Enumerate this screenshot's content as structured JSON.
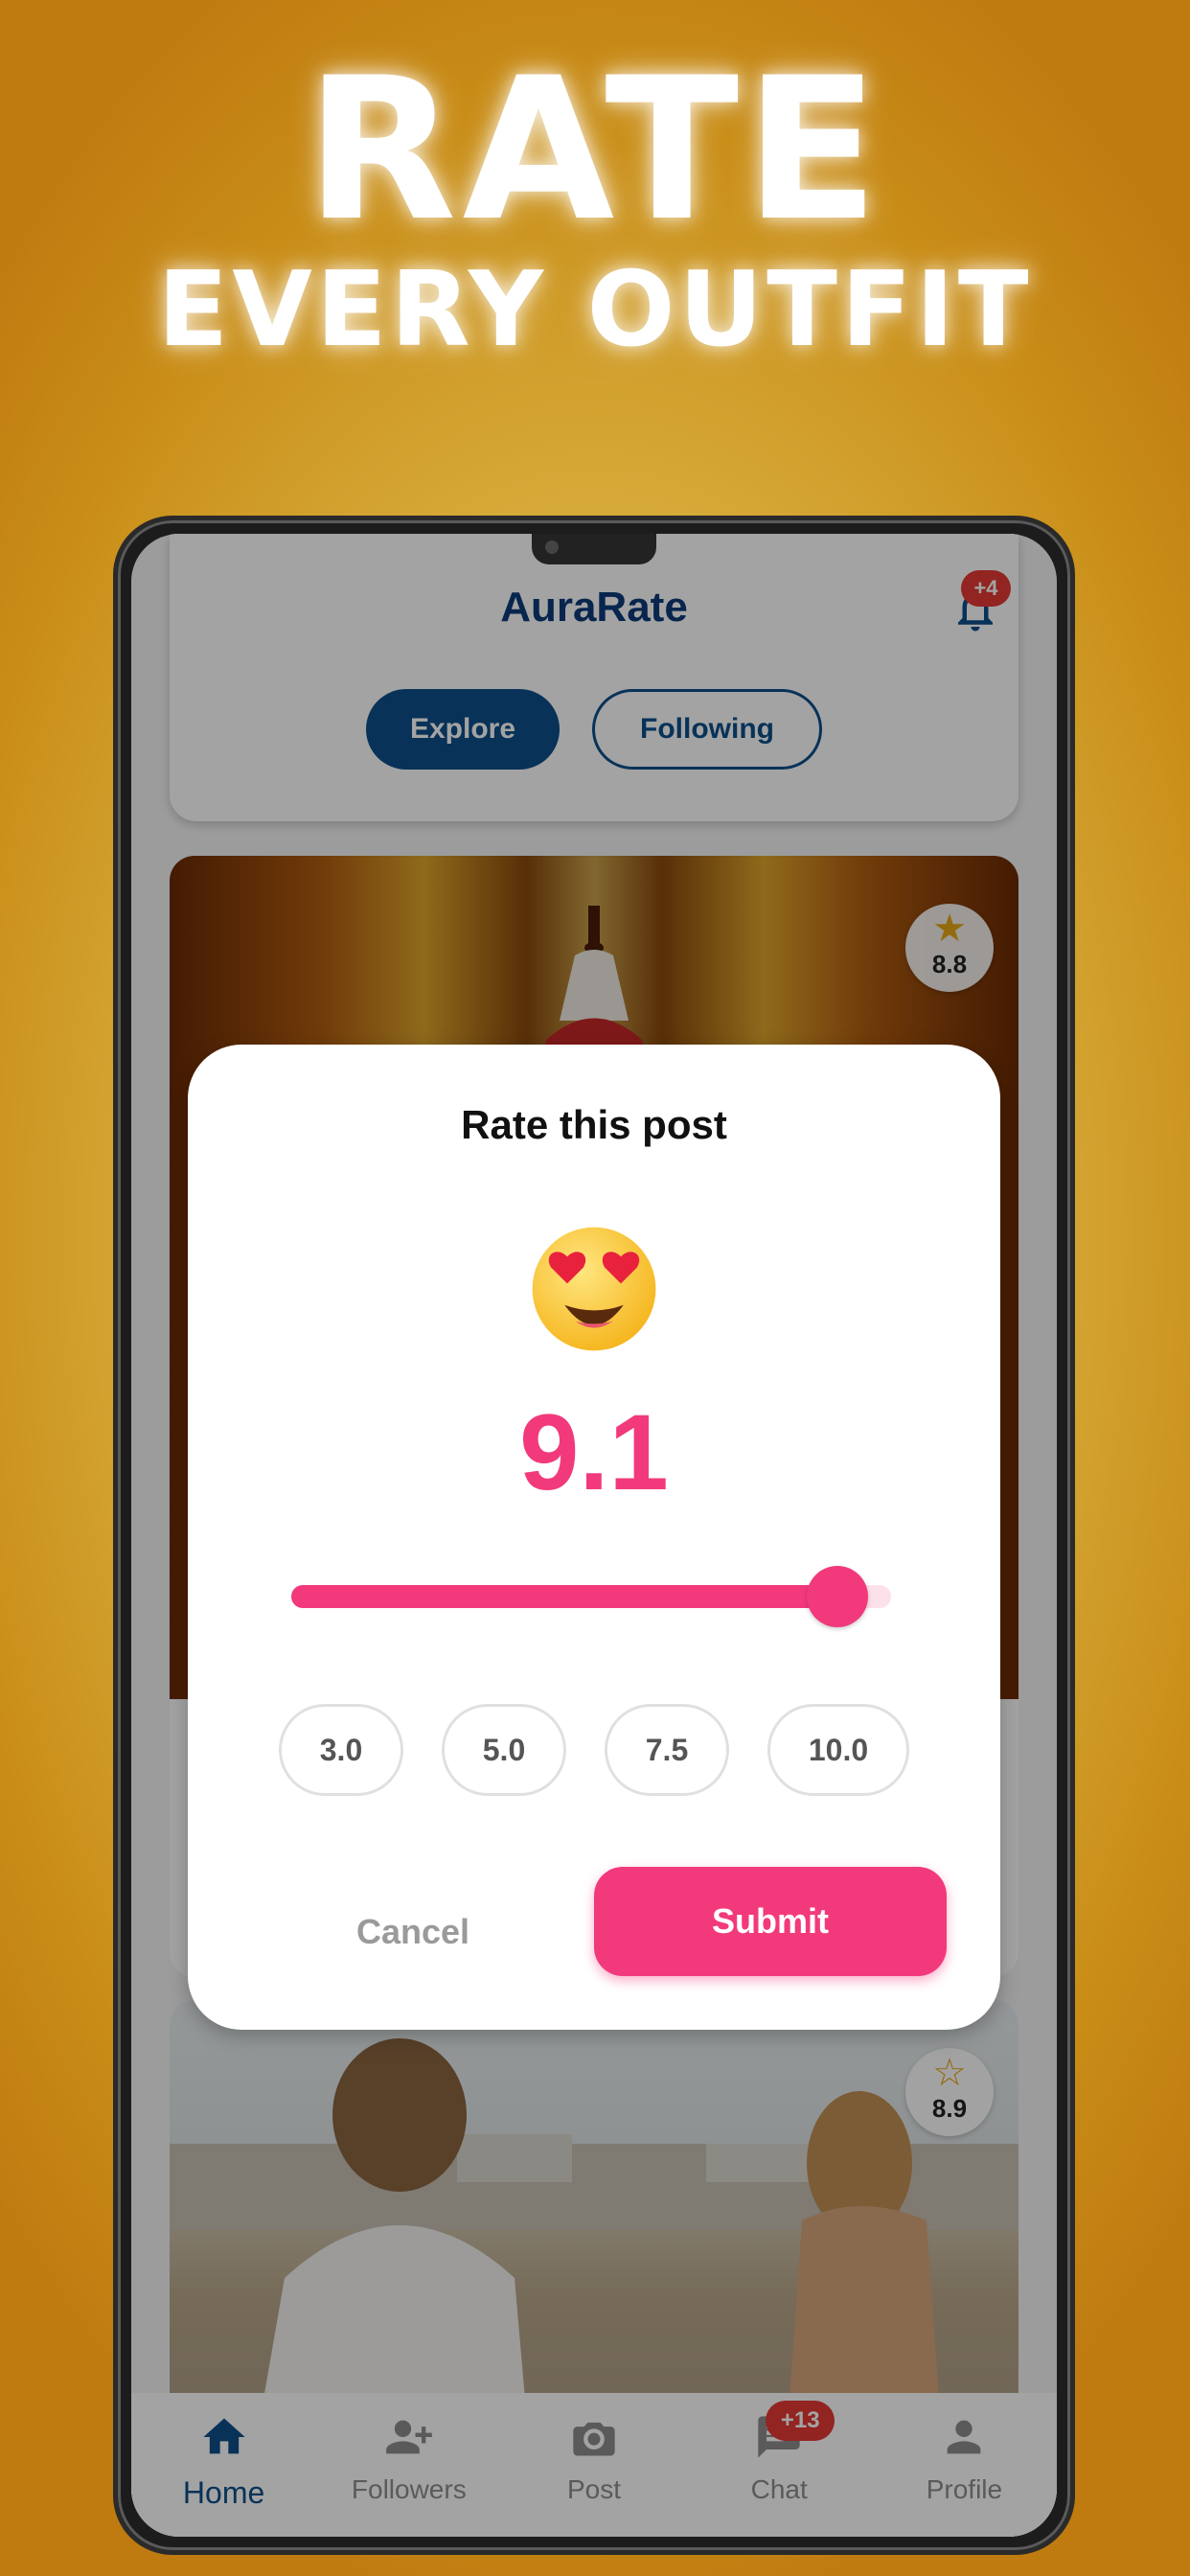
{
  "headline": {
    "line1": "RATE",
    "line2": "EVERY OUTFIT"
  },
  "app": {
    "title": "AuraRate",
    "notification_badge": "+4",
    "tabs": [
      {
        "label": "Explore",
        "active": true
      },
      {
        "label": "Following",
        "active": false
      }
    ]
  },
  "posts": [
    {
      "rating": "8.8",
      "star": "filled"
    },
    {
      "rating": "8.9",
      "star": "outline"
    }
  ],
  "rating_dialog": {
    "title": "Rate this post",
    "emoji": "heart-eyes",
    "score": "9.1",
    "slider_value": 9.1,
    "slider_max": 10,
    "presets": [
      "3.0",
      "5.0",
      "7.5",
      "10.0"
    ],
    "cancel_label": "Cancel",
    "submit_label": "Submit"
  },
  "bottom_nav": {
    "items": [
      {
        "label": "Home",
        "icon": "home-icon",
        "active": true
      },
      {
        "label": "Followers",
        "icon": "add-user-icon",
        "active": false
      },
      {
        "label": "Post",
        "icon": "camera-icon",
        "active": false
      },
      {
        "label": "Chat",
        "icon": "chat-icon",
        "active": false,
        "badge": "+13"
      },
      {
        "label": "Profile",
        "icon": "person-icon",
        "active": false
      }
    ]
  },
  "colors": {
    "accent": "#f2397c",
    "brand": "#0d4f8a",
    "badge": "#e53935"
  }
}
